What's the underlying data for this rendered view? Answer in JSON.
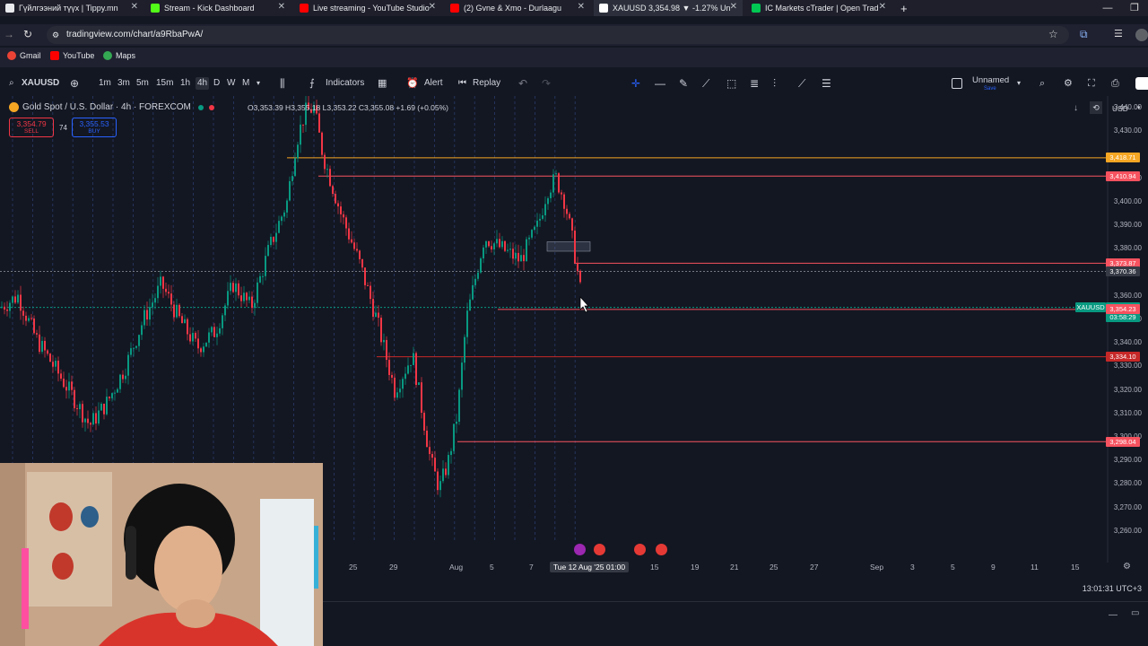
{
  "tabs": [
    {
      "title": "Гүйлгээний түүх | Tippy.mn",
      "fav": "#e8eaed"
    },
    {
      "title": "Stream - Kick Dashboard",
      "fav": "#53fc18"
    },
    {
      "title": "Live streaming - YouTube Studio",
      "fav": "#ff0000"
    },
    {
      "title": "(2) Gvne & Xmo - Durlaagu",
      "fav": "#ff0000"
    },
    {
      "title": "XAUUSD 3,354.98 ▼ -1.27% Un",
      "fav": "#ffffff"
    },
    {
      "title": "IC Markets cTrader | Open Trad",
      "fav": "#00c853"
    }
  ],
  "url": "tradingview.com/chart/a9RbaPwA/",
  "bookmarks": [
    "Gmail",
    "YouTube",
    "Maps"
  ],
  "toolbar": {
    "symbol": "XAUUSD",
    "intervals": [
      "1m",
      "3m",
      "5m",
      "15m",
      "1h",
      "4h",
      "D",
      "W",
      "M"
    ],
    "indicators": "Indicators",
    "alert": "Alert",
    "replay": "Replay",
    "layout_name": "Unnamed",
    "layout_sub": "Save",
    "currency": "USD"
  },
  "legend": {
    "title": "Gold Spot / U.S. Dollar · 4h · FOREXCOM",
    "ohlc": "O3,353.39  H3,355.18  L3,353.22  C3,355.08  +1.69 (+0.05%)",
    "sell_price": "3,354.79",
    "sell_label": "SELL",
    "spread": "74",
    "buy_price": "3,355.53",
    "buy_label": "BUY"
  },
  "chart_data": {
    "type": "candlestick",
    "symbol": "XAUUSD",
    "timeframe": "4h",
    "ylim": [
      3255,
      3445
    ],
    "y_ticks": [
      3440,
      3430,
      3410,
      3400,
      3390,
      3380,
      3360,
      3350,
      3340,
      3330,
      3320,
      3310,
      3300,
      3290,
      3280,
      3270,
      3260
    ],
    "x_ticks": [
      "25",
      "29",
      "Aug",
      "5",
      "7",
      "Tue 12 Aug '25",
      "01:00",
      "15",
      "19",
      "21",
      "25",
      "27",
      "Sep",
      "3",
      "5",
      "9",
      "11",
      "15"
    ],
    "horizontal_levels": [
      {
        "price": "3,418.71",
        "color": "#f5a623"
      },
      {
        "price": "3,410.94",
        "color": "#f7525f"
      },
      {
        "price": "3,373.87",
        "color": "#f7525f"
      },
      {
        "price": "3,370.36",
        "color": "#2a2e39"
      },
      {
        "price": "3,355.08",
        "color": "#089981",
        "label": "XAUUSD",
        "sublabel": "03:58:29"
      },
      {
        "price": "3,354.23",
        "color": "#f7525f"
      },
      {
        "price": "3,334.10",
        "color": "#c62828"
      },
      {
        "price": "3,298.04",
        "color": "#f7525f"
      }
    ],
    "price_path": [
      [
        0,
        3355
      ],
      [
        0.02,
        3360
      ],
      [
        0.04,
        3342
      ],
      [
        0.06,
        3330
      ],
      [
        0.08,
        3318
      ],
      [
        0.1,
        3305
      ],
      [
        0.12,
        3315
      ],
      [
        0.14,
        3330
      ],
      [
        0.16,
        3350
      ],
      [
        0.18,
        3365
      ],
      [
        0.2,
        3350
      ],
      [
        0.22,
        3338
      ],
      [
        0.24,
        3345
      ],
      [
        0.26,
        3365
      ],
      [
        0.28,
        3355
      ],
      [
        0.3,
        3380
      ],
      [
        0.32,
        3400
      ],
      [
        0.33,
        3425
      ],
      [
        0.34,
        3438
      ],
      [
        0.35,
        3440
      ],
      [
        0.36,
        3420
      ],
      [
        0.38,
        3395
      ],
      [
        0.4,
        3375
      ],
      [
        0.42,
        3350
      ],
      [
        0.44,
        3320
      ],
      [
        0.46,
        3335
      ],
      [
        0.48,
        3290
      ],
      [
        0.49,
        3278
      ],
      [
        0.5,
        3290
      ],
      [
        0.51,
        3310
      ],
      [
        0.52,
        3350
      ],
      [
        0.54,
        3385
      ],
      [
        0.56,
        3380
      ],
      [
        0.58,
        3375
      ],
      [
        0.6,
        3390
      ],
      [
        0.61,
        3405
      ],
      [
        0.62,
        3410
      ],
      [
        0.63,
        3400
      ],
      [
        0.64,
        3380
      ],
      [
        0.65,
        3355
      ]
    ]
  },
  "time_axis_highlight": "Tue 12 Aug '25  01:00",
  "clock": "13:01:31 UTC+3"
}
